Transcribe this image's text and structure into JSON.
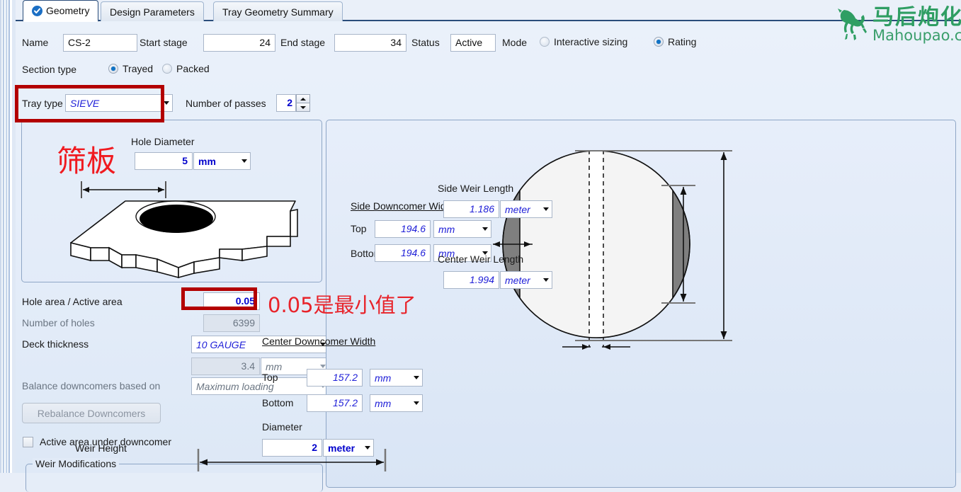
{
  "tabs": [
    {
      "label": "Geometry",
      "icon": "check-circle-icon",
      "active": true
    },
    {
      "label": "Design Parameters",
      "active": false
    },
    {
      "label": "Tray Geometry Summary",
      "active": false
    }
  ],
  "header": {
    "name_label": "Name",
    "name_value": "CS-2",
    "start_stage_label": "Start stage",
    "start_stage_value": "24",
    "end_stage_label": "End stage",
    "end_stage_value": "34",
    "status_label": "Status",
    "status_value": "Active",
    "mode_label": "Mode",
    "mode_interactive": "Interactive sizing",
    "mode_rating": "Rating",
    "mode_selected": "Rating"
  },
  "section_type": {
    "label": "Section type",
    "trayed": "Trayed",
    "packed": "Packed",
    "selected": "Trayed"
  },
  "tray": {
    "type_label": "Tray type",
    "type_value": "SIEVE",
    "passes_label": "Number of passes",
    "passes_value": "2"
  },
  "left_panel": {
    "hole_diameter_label": "Hole Diameter",
    "hole_diameter_value": "5",
    "hole_diameter_unit": "mm",
    "annotation_cn": "筛板"
  },
  "left_fields": {
    "hole_active_label": "Hole area / Active area",
    "hole_active_value": "0.05",
    "num_holes_label": "Number of holes",
    "num_holes_value": "6399",
    "deck_thickness_label": "Deck thickness",
    "deck_thickness_gauge": "10 GAUGE",
    "deck_thickness_value": "3.4",
    "deck_thickness_unit": "mm",
    "balance_label": "Balance downcomers based on",
    "balance_value": "Maximum loading",
    "rebalance_button": "Rebalance Downcomers",
    "active_area_checkbox": "Active area under downcomer",
    "weir_modifications_group": "Weir Modifications"
  },
  "annotations": {
    "min_value_note": "0.05是最小值了"
  },
  "diagram": {
    "side_downcomer_width_label": "Side Downcomer Width",
    "side_top_label": "Top",
    "side_top_value": "194.6",
    "side_top_unit": "mm",
    "side_bottom_label": "Bottom",
    "side_bottom_value": "194.6",
    "side_bottom_unit": "mm",
    "center_downcomer_width_label": "Center Downcomer Width",
    "center_top_label": "Top",
    "center_top_value": "157.2",
    "center_top_unit": "mm",
    "center_bottom_label": "Bottom",
    "center_bottom_value": "157.2",
    "center_bottom_unit": "mm",
    "diameter_label": "Diameter",
    "diameter_value": "2",
    "diameter_unit": "meter",
    "side_weir_length_label": "Side Weir Length",
    "side_weir_length_value": "1.186",
    "side_weir_length_unit": "meter",
    "center_weir_length_label": "Center Weir Length",
    "center_weir_length_value": "1.994",
    "center_weir_length_unit": "meter",
    "weir_height_label": "Weir Height"
  },
  "watermark": {
    "cn": "马后炮化工",
    "domain": "Mahoupao.com",
    "icon": "horse-logo-icon"
  },
  "colors": {
    "accent_blue": "#0000cc",
    "italic_blue": "#2020d8",
    "annotation_red": "#e8232a",
    "redbox_border": "#b30000",
    "watermark_green": "#2f9e63",
    "panel_bg": "#e6eefa"
  }
}
